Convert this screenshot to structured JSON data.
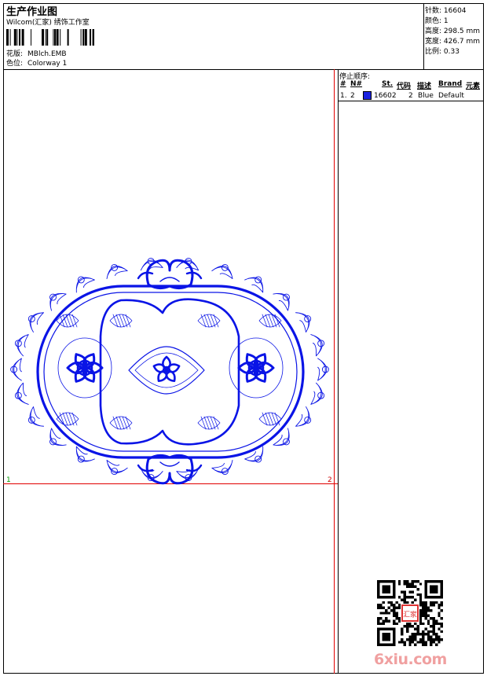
{
  "header": {
    "title": "生产作业图",
    "studio": "Wilcom(汇家) 绣饰工作室",
    "design_label": "花版:",
    "design_value": "MBlch.EMB",
    "colorway_label": "色位:",
    "colorway_value": "Colorway 1"
  },
  "stats": {
    "stitches": "针数: 16604",
    "colors": "颜色: 1",
    "height": "高度: 298.5 mm",
    "width": "宽度: 426.7 mm",
    "scale": "比例: 0.33"
  },
  "stop_sequence": {
    "title": "停止顺序:",
    "columns": [
      "#",
      "N#",
      "St.",
      "代码",
      "描述",
      "Brand",
      "元素"
    ],
    "rows": [
      {
        "index": "1.",
        "needle": "2",
        "stitches": "16602",
        "code": "2",
        "desc": "Blue",
        "brand": "Default",
        "element": ""
      }
    ]
  },
  "markers": {
    "start": "1",
    "end": "2"
  },
  "colors": {
    "thread": "#0a14e6",
    "guide": "#e00000",
    "swatch": "#1a22e0"
  },
  "watermark": "6xiu.com",
  "seal": "汇家"
}
